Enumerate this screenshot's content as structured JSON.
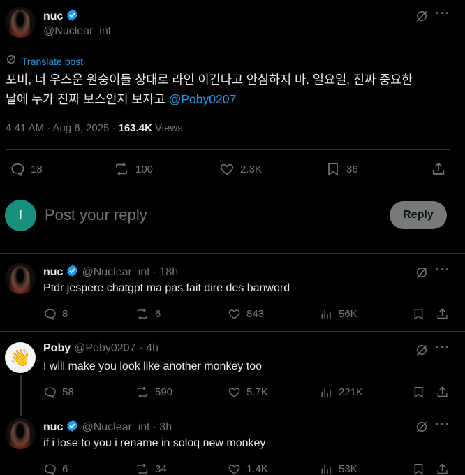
{
  "main_post": {
    "name": "nuc",
    "handle": "@Nuclear_int",
    "translate": "Translate post",
    "text_line1": "포비, 너 우스운 원숭이들 상대로 라인 이긴다고 안심하지 마. 일요일, 진짜 중요한",
    "text_line2": "날에 누가 진짜 보스인지 보자고",
    "mention": "@Poby0207",
    "time": "4:41 AM · Aug 6, 2025 ·",
    "views_count": "163.4K",
    "views_label": "Views",
    "replies": "18",
    "reposts": "100",
    "likes": "2.3K",
    "bookmarks": "36"
  },
  "composer": {
    "avatar_letter": "I",
    "placeholder": "Post your reply",
    "reply_label": "Reply"
  },
  "replies": [
    {
      "name": "nuc",
      "handle": "@Nuclear_int",
      "time": "· 18h",
      "text": "Ptdr jespere chatgpt ma pas fait dire des banword",
      "replies": "8",
      "reposts": "6",
      "likes": "843",
      "views": "56K"
    },
    {
      "name": "Poby",
      "handle": "@Poby0207",
      "time": "· 4h",
      "text": "I will make you look like another monkey too",
      "replies": "58",
      "reposts": "590",
      "likes": "5.7K",
      "views": "221K"
    },
    {
      "name": "nuc",
      "handle": "@Nuclear_int",
      "time": "· 3h",
      "text": "if i lose to you i rename in soloq new monkey",
      "replies": "6",
      "reposts": "34",
      "likes": "1.4K",
      "views": "53K"
    }
  ],
  "colors": {
    "background": "#000000",
    "accent": "#1d9bf0",
    "muted": "#71767b",
    "composer_avatar": "#17917d"
  },
  "icons": [
    "verified-icon",
    "grok-icon",
    "more-icon",
    "translate-icon",
    "reply-icon",
    "repost-icon",
    "like-icon",
    "bookmark-icon",
    "share-icon",
    "views-icon"
  ]
}
